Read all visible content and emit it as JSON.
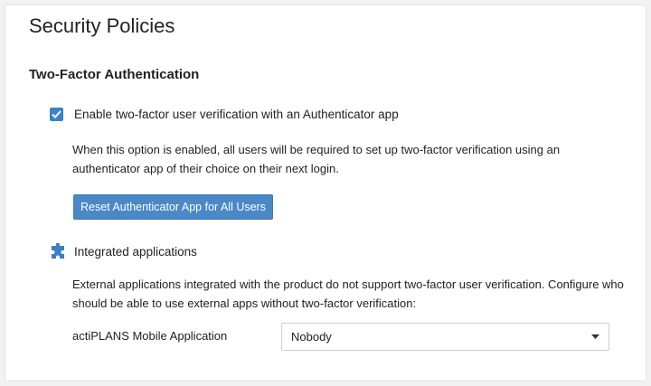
{
  "page": {
    "title": "Security Policies"
  },
  "two_factor": {
    "section_title": "Two-Factor Authentication",
    "checkbox_label": "Enable two-factor user verification with an Authenticator app",
    "checked": true,
    "description": "When this option is enabled, all users will be required to set up two-factor verification using an authenticator app of their choice on their next login.",
    "reset_button_label": "Reset Authenticator App for All Users"
  },
  "integrated_apps": {
    "icon": "puzzle-icon",
    "label": "Integrated applications",
    "description": "External applications integrated with the product do not support two-factor user verification. Configure who should be able to use external apps without two-factor verification:",
    "mobile_app_label": "actiPLANS Mobile Application",
    "mobile_app_select_value": "Nobody"
  },
  "colors": {
    "accent": "#3b82c4",
    "button": "#4a88c8",
    "icon": "#3d7fc1"
  }
}
